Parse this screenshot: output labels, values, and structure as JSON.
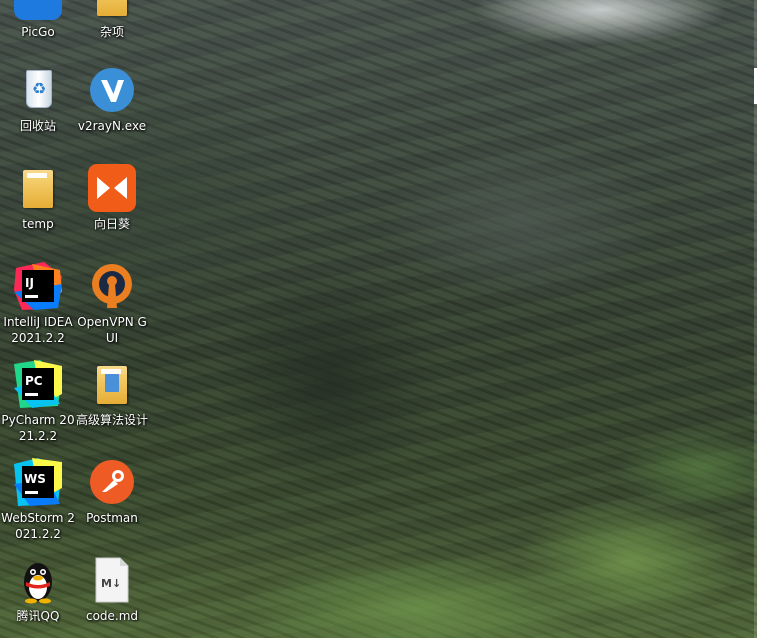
{
  "desktop": {
    "icons": [
      {
        "id": "picgo",
        "label": "PicGo"
      },
      {
        "id": "misc",
        "label": "杂项"
      },
      {
        "id": "recycle",
        "label": "回收站"
      },
      {
        "id": "v2rayn",
        "label": "v2rayN.exe"
      },
      {
        "id": "temp",
        "label": "temp"
      },
      {
        "id": "sunlogin",
        "label": "向日葵"
      },
      {
        "id": "idea",
        "label": "IntelliJ IDEA 2021.2.2"
      },
      {
        "id": "openvpn",
        "label": "OpenVPN GUI"
      },
      {
        "id": "pycharm",
        "label": "PyCharm 2021.2.2"
      },
      {
        "id": "algo",
        "label": "高级算法设计"
      },
      {
        "id": "webstorm",
        "label": "WebStorm 2021.2.2"
      },
      {
        "id": "postman",
        "label": "Postman"
      },
      {
        "id": "qq",
        "label": "腾讯QQ"
      },
      {
        "id": "codemd",
        "label": "code.md"
      }
    ],
    "glyph_text": {
      "idea": "IJ",
      "pycharm": "PC",
      "webstorm": "WS",
      "markdown": "M↓"
    },
    "colors": {
      "v2rayn": "#3b8fd6",
      "sunlogin": "#f25c19",
      "openvpn": "#ea7e20",
      "postman": "#ef5b25",
      "qq_body": "#111111"
    }
  }
}
